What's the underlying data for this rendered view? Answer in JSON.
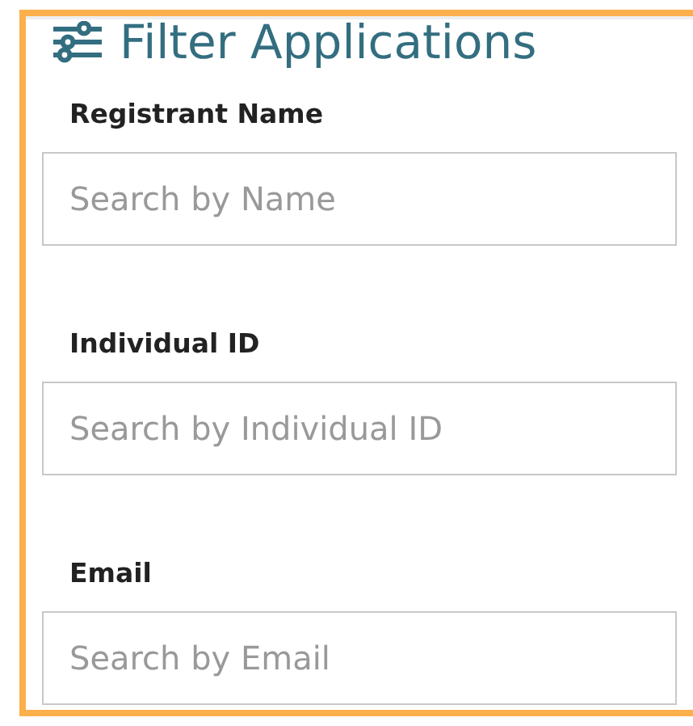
{
  "panel": {
    "title": "Filter Applications",
    "fields": [
      {
        "label": "Registrant Name",
        "placeholder": "Search by Name"
      },
      {
        "label": "Individual ID",
        "placeholder": "Search by Individual ID"
      },
      {
        "label": "Email",
        "placeholder": "Search by Email"
      }
    ]
  }
}
